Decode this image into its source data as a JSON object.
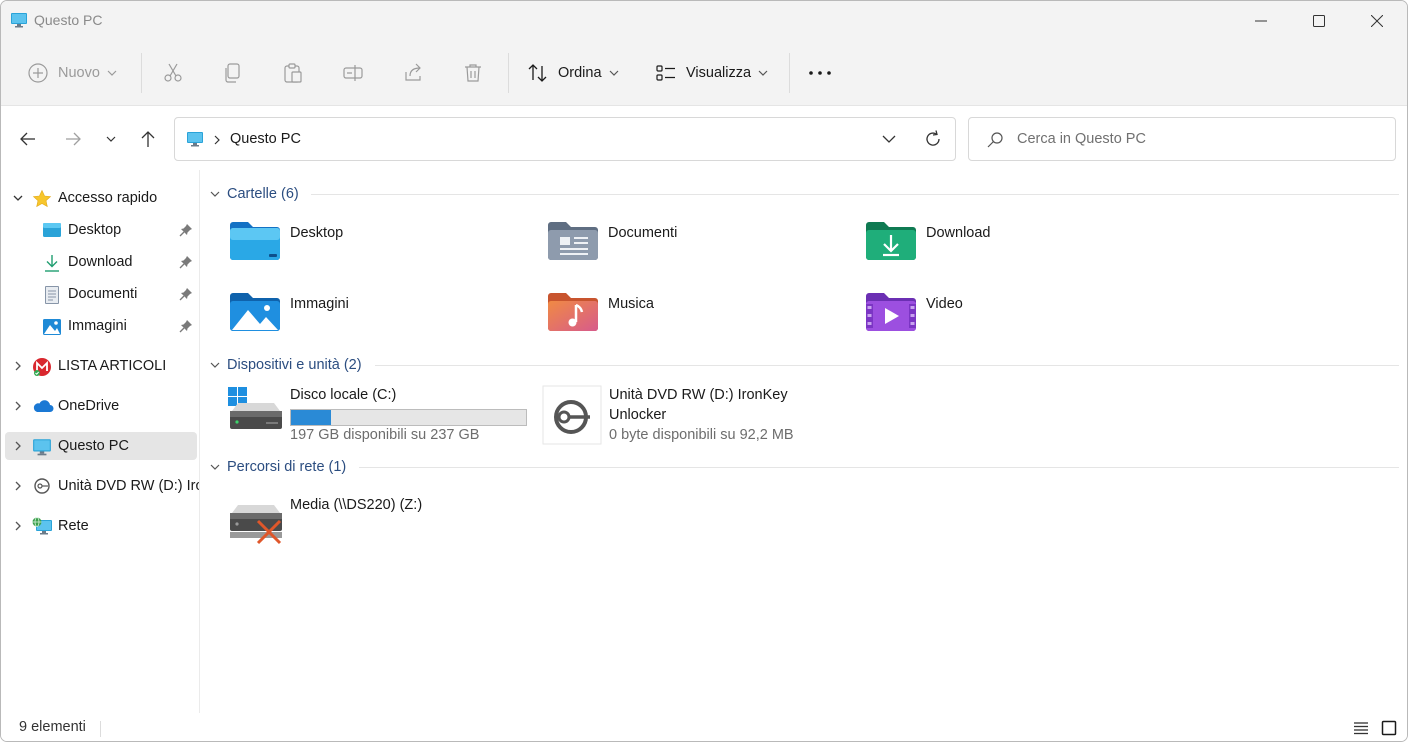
{
  "window": {
    "title": "Questo PC"
  },
  "toolbar": {
    "new_label": "Nuovo",
    "sort_label": "Ordina",
    "view_label": "Visualizza"
  },
  "address": {
    "location": "Questo PC",
    "search_placeholder": "Cerca in Questo PC"
  },
  "sidebar": {
    "items": [
      {
        "label": "Accesso rapido",
        "icon": "star-icon"
      },
      {
        "label": "Desktop",
        "icon": "desktop-folder-icon",
        "pinned": true
      },
      {
        "label": "Download",
        "icon": "download-icon",
        "pinned": true
      },
      {
        "label": "Documenti",
        "icon": "document-icon",
        "pinned": true
      },
      {
        "label": "Immagini",
        "icon": "pictures-icon",
        "pinned": true
      },
      {
        "label": "LISTA ARTICOLI",
        "icon": "mega-icon"
      },
      {
        "label": "OneDrive",
        "icon": "cloud-icon"
      },
      {
        "label": "Questo PC",
        "icon": "monitor-icon",
        "selected": true
      },
      {
        "label": "Unità DVD RW (D:) IronKey Unlocker",
        "icon": "disc-drive-icon"
      },
      {
        "label": "Rete",
        "icon": "network-icon"
      }
    ]
  },
  "groups": {
    "folders": {
      "title": "Cartelle (6)",
      "items": [
        {
          "label": "Desktop",
          "icon": "desktop-folder-icon"
        },
        {
          "label": "Documenti",
          "icon": "documents-folder-icon"
        },
        {
          "label": "Download",
          "icon": "downloads-folder-icon"
        },
        {
          "label": "Immagini",
          "icon": "pictures-folder-icon"
        },
        {
          "label": "Musica",
          "icon": "music-folder-icon"
        },
        {
          "label": "Video",
          "icon": "videos-folder-icon"
        }
      ]
    },
    "devices": {
      "title": "Dispositivi e unità (2)",
      "items": [
        {
          "name": "Disco locale (C:)",
          "space": "197 GB disponibili su 237 GB",
          "used_fraction": 0.17,
          "icon": "windows-drive-icon"
        },
        {
          "name": "Unità DVD RW (D:) IronKey Unlocker",
          "space": "0 byte disponibili su 92,2 MB",
          "icon": "ironkey-drive-icon"
        }
      ]
    },
    "network": {
      "title": "Percorsi di rete (1)",
      "items": [
        {
          "name": "Media (\\\\DS220) (Z:)",
          "icon": "disconnected-network-drive-icon"
        }
      ]
    }
  },
  "status": {
    "count": "9 elementi"
  },
  "colors": {
    "accent": "#2a8ad6",
    "group_title": "#2b4d80",
    "selection": "#e5e5e5"
  }
}
